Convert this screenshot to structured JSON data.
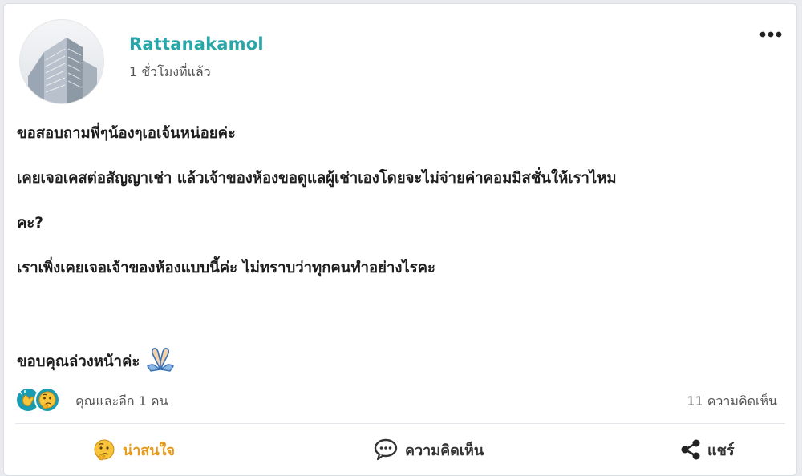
{
  "post": {
    "author": "Rattanakamol",
    "time": "1 ชั่วโมงที่แล้ว",
    "lines": [
      "ขอสอบถามพี่ๆน้องๆเอเจ้นหน่อยค่ะ",
      "เคยเจอเคสต่อสัญญาเช่า แล้วเจ้าของห้องขอดูแลผู้เช่าเองโดยจะไม่จ่ายค่าคอมมิสชั่นให้เราไหม",
      "คะ?",
      "เราเพิ่งเคยเจอเจ้าของห้องแบบนี้ค่ะ ไม่ทราบว่าทุกคนทำอย่างไรคะ",
      "ขอบคุณล่วงหน้าค่ะ"
    ]
  },
  "reactions": {
    "summary": "คุณและอีก 1 คน",
    "comment_count": "11 ความคิดเห็น",
    "icons": [
      "clap-icon",
      "thinking-face-icon"
    ]
  },
  "actions": {
    "interest": "น่าสนใจ",
    "comment": "ความคิดเห็น",
    "share": "แชร์"
  },
  "colors": {
    "author": "#2aa6a9",
    "interest": "#e79a1b",
    "reaction_clap_bg": "#1b9bb0",
    "reaction_think_bg": "#1b9bb0"
  }
}
